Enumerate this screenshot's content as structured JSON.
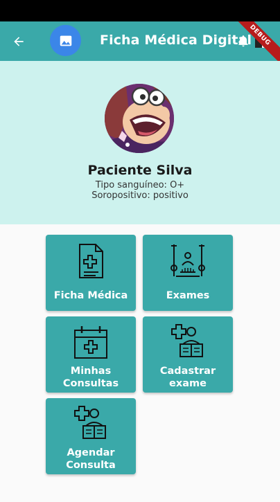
{
  "app_bar": {
    "title": "Ficha Médica Digital",
    "back_icon": "arrow-left-icon",
    "logo_icon": "image-icon",
    "notification_icon": "bell-icon",
    "exit_icon": "exit-door-icon",
    "debug_banner": "DEBUG"
  },
  "profile": {
    "name": "Paciente Silva",
    "blood_type": "Tipo sanguíneo: O+",
    "seropositive": "Soropositivo: positivo"
  },
  "menu": {
    "ficha_medica": "Ficha Médica",
    "exames": "Exames",
    "minhas_consultas_1": "Minhas",
    "minhas_consultas_2": "Consultas",
    "cadastrar_exame_1": "Cadastrar",
    "cadastrar_exame_2": "exame",
    "agendar_consulta_1": "Agendar",
    "agendar_consulta_2": "Consulta"
  },
  "colors": {
    "primary": "#3aa9a9",
    "profile_background": "#cdf2ee",
    "logo": "#3b86e8",
    "debug": "#b71c1c"
  }
}
